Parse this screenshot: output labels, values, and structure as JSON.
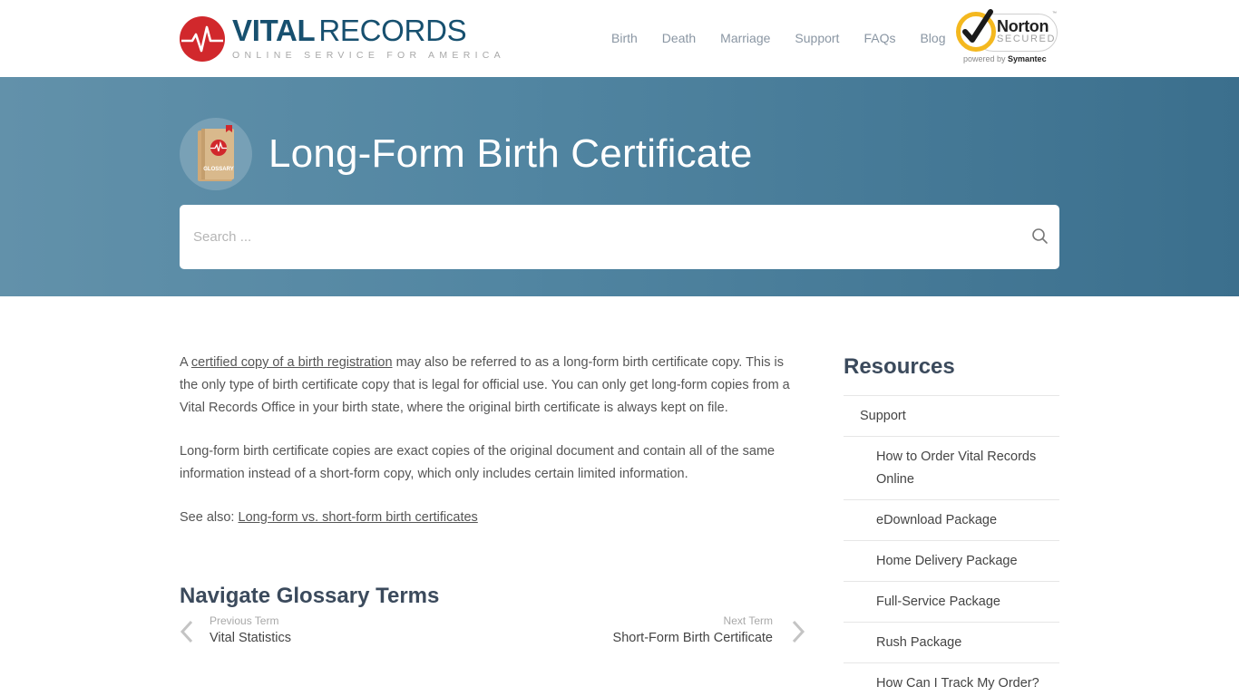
{
  "header": {
    "logo": {
      "title_bold": "VITAL",
      "title_light": "RECORDS",
      "tagline": "ONLINE SERVICE FOR AMERICA",
      "brand_color": "#17506f",
      "icon_color": "#d1282c"
    },
    "nav": [
      {
        "label": "Birth"
      },
      {
        "label": "Death"
      },
      {
        "label": "Marriage"
      },
      {
        "label": "Support"
      },
      {
        "label": "FAQs"
      },
      {
        "label": "Blog"
      }
    ],
    "norton": {
      "name": "Norton",
      "secured": "SECURED",
      "tm": "™",
      "powered_by": "powered by",
      "symantec": "Symantec"
    }
  },
  "hero": {
    "icon_label": "GLOSSARY",
    "title": "Long-Form Birth Certificate",
    "search": {
      "placeholder": "Search ...",
      "value": ""
    },
    "gradient": [
      "#6291aa",
      "#3b6f8d"
    ]
  },
  "content": {
    "p1_prefix": "A ",
    "p1_link": "certified copy of a birth registration",
    "p1_rest": " may also be referred to as a long-form birth certificate copy. This is the only type of birth certificate copy that is legal for official use. You can only get long-form copies from a Vital Records Office in your birth state, where the original birth certificate is always kept on file.",
    "p2": "Long-form birth certificate copies are exact copies of the original document and contain all of the same information instead of a short-form copy, which only includes certain limited information.",
    "p3_prefix": "See also: ",
    "p3_link": "Long-form vs. short-form birth certificates"
  },
  "glossary_nav": {
    "title": "Navigate Glossary Terms",
    "previous": {
      "label": "Previous Term",
      "term": "Vital Statistics"
    },
    "next": {
      "label": "Next Term",
      "term": "Short-Form Birth Certificate"
    }
  },
  "sidebar": {
    "title": "Resources",
    "items": [
      {
        "label": "Support",
        "level": "parent"
      },
      {
        "label": "How to Order Vital Records Online",
        "level": "child"
      },
      {
        "label": "eDownload Package",
        "level": "child"
      },
      {
        "label": "Home Delivery Package",
        "level": "child"
      },
      {
        "label": "Full-Service Package",
        "level": "child"
      },
      {
        "label": "Rush Package",
        "level": "child"
      },
      {
        "label": "How Can I Track My Order?",
        "level": "child"
      }
    ]
  }
}
